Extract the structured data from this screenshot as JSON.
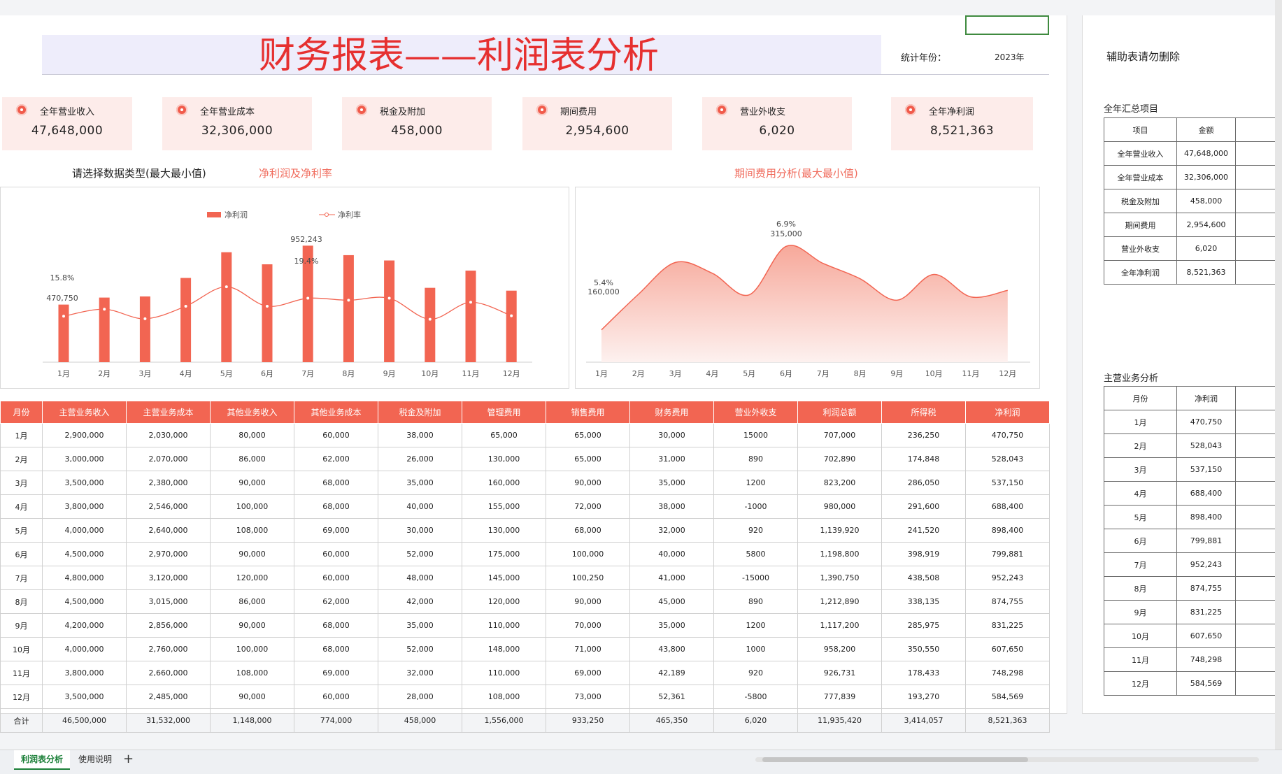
{
  "header": {
    "title": "财务报表——利润表分析",
    "year_label": "统计年份：",
    "year_value": "2023年"
  },
  "kpis": [
    {
      "label": "全年营业收入",
      "value": "47,648,000"
    },
    {
      "label": "全年营业成本",
      "value": "32,306,000"
    },
    {
      "label": "税金及附加",
      "value": "458,000"
    },
    {
      "label": "期间费用",
      "value": "2,954,600"
    },
    {
      "label": "营业外收支",
      "value": "6,020"
    },
    {
      "label": "全年净利润",
      "value": "8,521,363"
    }
  ],
  "labels": {
    "select_type": "请选择数据类型(最大最小值)",
    "chart1_title": "净利润及净利率",
    "chart2_title": "期间费用分析(最大最小值)"
  },
  "chart_data": [
    {
      "type": "bar",
      "title": "净利润及净利率",
      "categories": [
        "1月",
        "2月",
        "3月",
        "4月",
        "5月",
        "6月",
        "7月",
        "8月",
        "9月",
        "10月",
        "11月",
        "12月"
      ],
      "series": [
        {
          "name": "净利润",
          "values": [
            470750,
            528043,
            537150,
            688400,
            898400,
            799881,
            952243,
            874755,
            831225,
            607650,
            748298,
            584569
          ]
        },
        {
          "name": "净利率",
          "values": [
            15.8,
            17.2,
            15.3,
            17.8,
            21.7,
            17.8,
            19.4,
            19.0,
            19.4,
            15.2,
            18.6,
            15.9
          ]
        }
      ],
      "annotations": [
        "15.8%",
        "470,750",
        "952,243",
        "19.4%"
      ],
      "legend": "top"
    },
    {
      "type": "area",
      "title": "期间费用分析(最大最小值)",
      "categories": [
        "1月",
        "2月",
        "3月",
        "4月",
        "5月",
        "6月",
        "7月",
        "8月",
        "9月",
        "10月",
        "11月",
        "12月"
      ],
      "values": [
        160000,
        226000,
        285000,
        265000,
        225000,
        315000,
        283250,
        255000,
        215000,
        262800,
        221189,
        233361
      ],
      "annotations": [
        "5.4%",
        "160,000",
        "6.9%",
        "315,000"
      ]
    }
  ],
  "table": {
    "headers": [
      "月份",
      "主营业务收入",
      "主营业务成本",
      "其他业务收入",
      "其他业务成本",
      "税金及附加",
      "管理费用",
      "销售费用",
      "财务费用",
      "营业外收支",
      "利润总额",
      "所得税",
      "净利润"
    ],
    "rows": [
      [
        "1月",
        "2,900,000",
        "2,030,000",
        "80,000",
        "60,000",
        "38,000",
        "65,000",
        "65,000",
        "30,000",
        "15000",
        "707,000",
        "236,250",
        "470,750"
      ],
      [
        "2月",
        "3,000,000",
        "2,070,000",
        "86,000",
        "62,000",
        "26,000",
        "130,000",
        "65,000",
        "31,000",
        "890",
        "702,890",
        "174,848",
        "528,043"
      ],
      [
        "3月",
        "3,500,000",
        "2,380,000",
        "90,000",
        "68,000",
        "35,000",
        "160,000",
        "90,000",
        "35,000",
        "1200",
        "823,200",
        "286,050",
        "537,150"
      ],
      [
        "4月",
        "3,800,000",
        "2,546,000",
        "100,000",
        "68,000",
        "40,000",
        "155,000",
        "72,000",
        "38,000",
        "-1000",
        "980,000",
        "291,600",
        "688,400"
      ],
      [
        "5月",
        "4,000,000",
        "2,640,000",
        "108,000",
        "69,000",
        "30,000",
        "130,000",
        "68,000",
        "32,000",
        "920",
        "1,139,920",
        "241,520",
        "898,400"
      ],
      [
        "6月",
        "4,500,000",
        "2,970,000",
        "90,000",
        "60,000",
        "52,000",
        "175,000",
        "100,000",
        "40,000",
        "5800",
        "1,198,800",
        "398,919",
        "799,881"
      ],
      [
        "7月",
        "4,800,000",
        "3,120,000",
        "120,000",
        "60,000",
        "48,000",
        "145,000",
        "100,250",
        "41,000",
        "-15000",
        "1,390,750",
        "438,508",
        "952,243"
      ],
      [
        "8月",
        "4,500,000",
        "3,015,000",
        "86,000",
        "62,000",
        "42,000",
        "120,000",
        "90,000",
        "45,000",
        "890",
        "1,212,890",
        "338,135",
        "874,755"
      ],
      [
        "9月",
        "4,200,000",
        "2,856,000",
        "90,000",
        "68,000",
        "35,000",
        "110,000",
        "70,000",
        "35,000",
        "1200",
        "1,117,200",
        "285,975",
        "831,225"
      ],
      [
        "10月",
        "4,000,000",
        "2,760,000",
        "100,000",
        "68,000",
        "52,000",
        "148,000",
        "71,000",
        "43,800",
        "1000",
        "958,200",
        "350,550",
        "607,650"
      ],
      [
        "11月",
        "3,800,000",
        "2,660,000",
        "108,000",
        "69,000",
        "32,000",
        "110,000",
        "69,000",
        "42,189",
        "920",
        "926,731",
        "178,433",
        "748,298"
      ],
      [
        "12月",
        "3,500,000",
        "2,485,000",
        "90,000",
        "60,000",
        "28,000",
        "108,000",
        "73,000",
        "52,361",
        "-5800",
        "777,839",
        "193,270",
        "584,569"
      ],
      [
        "合计",
        "46,500,000",
        "31,532,000",
        "1,148,000",
        "774,000",
        "458,000",
        "1,556,000",
        "933,250",
        "465,350",
        "6,020",
        "11,935,420",
        "3,414,057",
        "8,521,363"
      ]
    ]
  },
  "side": {
    "note": "辅助表请勿删除",
    "summary_title": "全年汇总项目",
    "summary_headers": [
      "项目",
      "金额"
    ],
    "summary_rows": [
      [
        "全年营业收入",
        "47,648,000"
      ],
      [
        "全年营业成本",
        "32,306,000"
      ],
      [
        "税金及附加",
        "458,000"
      ],
      [
        "期间费用",
        "2,954,600"
      ],
      [
        "营业外收支",
        "6,020"
      ],
      [
        "全年净利润",
        "8,521,363"
      ]
    ],
    "analysis_title": "主营业务分析",
    "analysis_headers": [
      "月份",
      "净利润"
    ],
    "analysis_rows": [
      [
        "1月",
        "470,750"
      ],
      [
        "2月",
        "528,043"
      ],
      [
        "3月",
        "537,150"
      ],
      [
        "4月",
        "688,400"
      ],
      [
        "5月",
        "898,400"
      ],
      [
        "6月",
        "799,881"
      ],
      [
        "7月",
        "952,243"
      ],
      [
        "8月",
        "874,755"
      ],
      [
        "9月",
        "831,225"
      ],
      [
        "10月",
        "607,650"
      ],
      [
        "11月",
        "748,298"
      ],
      [
        "12月",
        "584,569"
      ]
    ]
  },
  "tabs": {
    "active": "利润表分析",
    "other": "使用说明",
    "add": "+"
  },
  "colors": {
    "accent": "#f26552",
    "title_red": "#e63030",
    "kpi_bg": "#fdecea"
  }
}
